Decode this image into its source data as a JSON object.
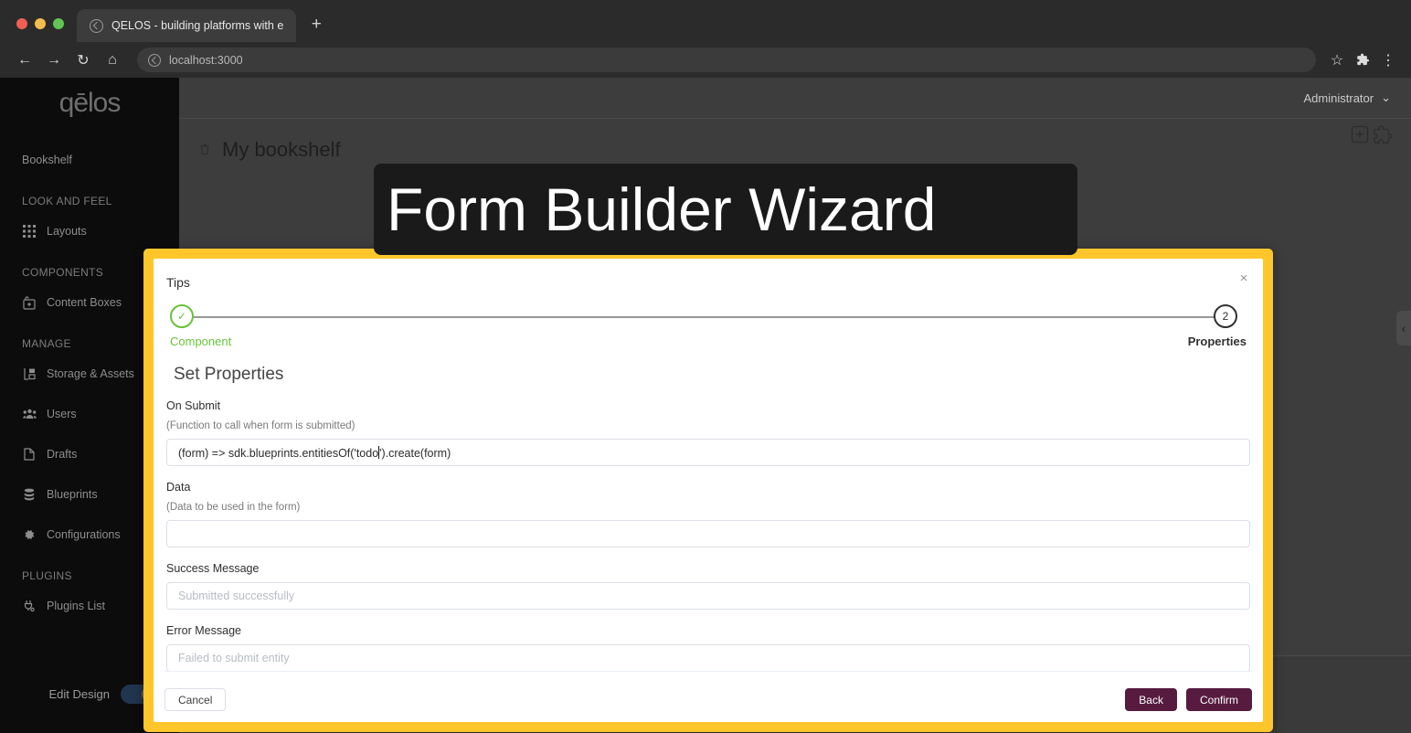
{
  "browser": {
    "tab": {
      "title": "QELOS - building platforms with e",
      "favicon": "globe-icon"
    },
    "new_tab_label": "+",
    "nav": {
      "back": "←",
      "forward": "→",
      "reload": "↻",
      "home": "⌂"
    },
    "omnibox": {
      "url": "localhost:3000"
    },
    "actions": {
      "bookmark": "☆",
      "extensions": "puzzle-icon",
      "menu": "⋮"
    }
  },
  "sidebar": {
    "logo": "qēlos",
    "top_items": [
      {
        "label": "Bookshelf",
        "icon": ""
      }
    ],
    "groups": [
      {
        "title": "LOOK AND FEEL",
        "items": [
          {
            "label": "Layouts",
            "icon": "grid-icon"
          }
        ]
      },
      {
        "title": "COMPONENTS",
        "items": [
          {
            "label": "Content Boxes",
            "icon": "box-icon"
          }
        ]
      },
      {
        "title": "MANAGE",
        "items": [
          {
            "label": "Storage & Assets",
            "icon": "storage-icon"
          },
          {
            "label": "Users",
            "icon": "users-icon"
          },
          {
            "label": "Drafts",
            "icon": "document-icon"
          },
          {
            "label": "Blueprints",
            "icon": "database-icon"
          },
          {
            "label": "Configurations",
            "icon": "gear-icon"
          }
        ]
      },
      {
        "title": "PLUGINS",
        "items": [
          {
            "label": "Plugins List",
            "icon": "plug-icon"
          }
        ]
      }
    ],
    "edit_design": {
      "label": "Edit Design",
      "enabled": true
    }
  },
  "topbar": {
    "user": "Administrator",
    "chevron": "⌄"
  },
  "page": {
    "title": "My bookshelf",
    "trash_icon": "trash-icon",
    "add_icon": "plus-box-icon",
    "puzzle_icon": "puzzle-piece-icon",
    "collapse_handle": "‹"
  },
  "overlay": {
    "title": "Form Builder Wizard"
  },
  "modal": {
    "title": "Tips",
    "close_icon": "×",
    "steps": [
      {
        "number": "✓",
        "label": "Component",
        "state": "done"
      },
      {
        "number": "2",
        "label": "Properties",
        "state": "active"
      }
    ],
    "section_title": "Set Properties",
    "fields": [
      {
        "label": "On Submit",
        "hint": "(Function to call when form is submitted)",
        "value": "(form) => sdk.blueprints.entitiesOf('todo').create(form)",
        "placeholder": "",
        "has_caret": true
      },
      {
        "label": "Data",
        "hint": "(Data to be used in the form)",
        "value": "",
        "placeholder": "",
        "has_caret": false
      },
      {
        "label": "Success Message",
        "hint": "",
        "value": "",
        "placeholder": "Submitted successfully",
        "has_caret": false
      },
      {
        "label": "Error Message",
        "hint": "",
        "value": "",
        "placeholder": "Failed to submit entity",
        "has_caret": false
      }
    ],
    "buttons": {
      "cancel": "Cancel",
      "back": "Back",
      "confirm": "Confirm"
    },
    "colors": {
      "border": "#FFC62B",
      "primary": "#561b3f",
      "done": "#67C23A"
    }
  }
}
